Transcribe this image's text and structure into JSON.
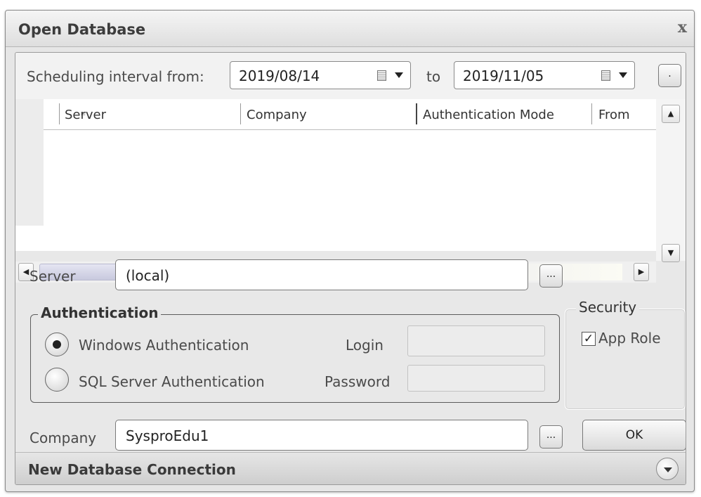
{
  "window": {
    "title": "Open Database",
    "close_glyph": "x"
  },
  "schedule": {
    "from_label": "Scheduling interval from:",
    "from_date": "2019/08/14",
    "to_label": "to",
    "to_date": "2019/11/05",
    "ellipsis_label": "."
  },
  "grid": {
    "columns": [
      "Server",
      "Company",
      "Authentication Mode",
      "From"
    ],
    "rows": []
  },
  "server": {
    "label": "Server",
    "value": "(local)",
    "browse_label": "..."
  },
  "authentication": {
    "legend": "Authentication",
    "windows_label": "Windows Authentication",
    "sql_label": "SQL Server Authentication",
    "selected": "windows",
    "login_label": "Login",
    "login_value": "",
    "password_label": "Password",
    "password_value": ""
  },
  "security": {
    "legend": "Security",
    "app_role_label": "App Role",
    "app_role_checked": true,
    "check_glyph": "✓"
  },
  "company": {
    "label": "Company",
    "value": "SysproEdu1",
    "browse_label": "..."
  },
  "ok_label": "OK",
  "footer": {
    "title": "New Database Connection"
  }
}
